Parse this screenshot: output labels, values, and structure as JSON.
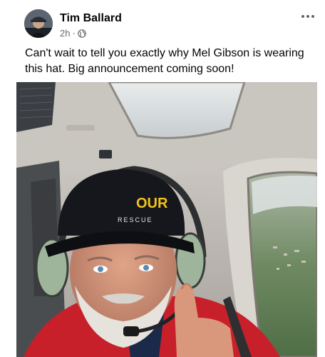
{
  "post": {
    "author": "Tim Ballard",
    "time": "2h",
    "separator": "·",
    "privacy_icon": "globe-icon",
    "more_icon": "more-options-icon",
    "text": "Can't wait to tell you exactly why Mel Gibson is wearing this hat. Big announcement coming soon!"
  },
  "photo": {
    "hat_logo": "OUR",
    "hat_text": "RESCUE"
  },
  "colors": {
    "text": "#050505",
    "secondary": "#65676b",
    "hat": "#15171c",
    "logo": "#f2c21b",
    "jacket": "#c8202a"
  }
}
